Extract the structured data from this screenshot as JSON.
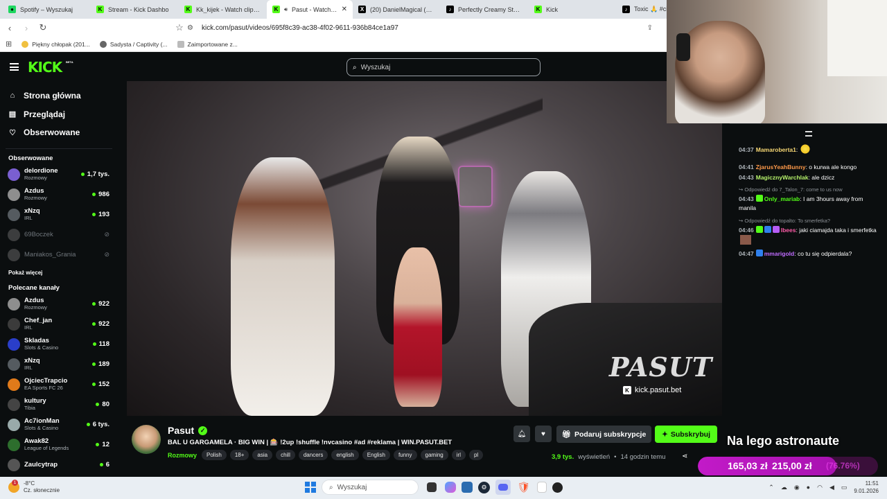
{
  "browser": {
    "tabs": [
      {
        "label": "Spotify – Wyszukaj",
        "color": "#1ed760",
        "glyph": "●"
      },
      {
        "label": "Stream - Kick Dashbo",
        "color": "#53fc18",
        "glyph": "K"
      },
      {
        "label": "Kk_kijek - Watch clips on",
        "color": "#53fc18",
        "glyph": "K"
      },
      {
        "label": "Pasut - Watch the",
        "color": "#53fc18",
        "glyph": "K",
        "active": true
      },
      {
        "label": "(20) DanielMagical (@dan",
        "color": "#000000",
        "glyph": "X"
      },
      {
        "label": "Perfectly Creamy Starbuck",
        "color": "#000000",
        "glyph": "♪"
      },
      {
        "label": "Kick",
        "color": "#53fc18",
        "glyph": "K"
      },
      {
        "label": "Toxic 🙏 #cio",
        "color": "#000000",
        "glyph": "♪"
      }
    ],
    "url": "kick.com/pasut/videos/695f8c39-ac38-4f02-9611-936b84ce1a97",
    "bookmarks": [
      "Piękny chłopak (201...",
      "Sadysta / Captivity (...",
      "Zaimportowane z..."
    ]
  },
  "header": {
    "logo": "KICK",
    "beta": "BETA",
    "search_placeholder": "Wyszukaj"
  },
  "sidebar": {
    "nav": [
      {
        "label": "Strona główna",
        "icon": "home-icon"
      },
      {
        "label": "Przeglądaj",
        "icon": "browse-icon"
      },
      {
        "label": "Obserwowane",
        "icon": "heart-icon"
      }
    ],
    "followed_heading": "Obserwowane",
    "followed": [
      {
        "name": "delordione",
        "category": "Rozmowy",
        "viewers": "1,7 tys.",
        "color": "#7a5fd1"
      },
      {
        "name": "Azdus",
        "category": "Rozmowy",
        "viewers": "986",
        "color": "#8e8e8e"
      },
      {
        "name": "xNzq",
        "category": "IRL",
        "viewers": "193",
        "color": "#555b60"
      },
      {
        "name": "69Boczek",
        "offline": true,
        "color": "#777"
      },
      {
        "name": "Maniakos_Grania",
        "offline": true,
        "color": "#777"
      }
    ],
    "show_more": "Pokaż więcej",
    "recommended_heading": "Polecane kanały",
    "recommended": [
      {
        "name": "Azdus",
        "category": "Rozmowy",
        "viewers": "922",
        "color": "#8e8e8e"
      },
      {
        "name": "Chef_jan",
        "category": "IRL",
        "viewers": "922",
        "color": "#3b3b3b"
      },
      {
        "name": "Skladas",
        "category": "Slots & Casino",
        "viewers": "118",
        "color": "#2a3ec9"
      },
      {
        "name": "xNzq",
        "category": "IRL",
        "viewers": "189",
        "color": "#555b60"
      },
      {
        "name": "OjciecTrapcio",
        "category": "EA Sports FC 26",
        "viewers": "152",
        "color": "#e07a1a"
      },
      {
        "name": "kultury",
        "category": "Tibia",
        "viewers": "80",
        "color": "#444"
      },
      {
        "name": "Ac7ionMan",
        "category": "Slots & Casino",
        "viewers": "6 tys.",
        "color": "#9aa"
      },
      {
        "name": "Awak82",
        "category": "League of Legends",
        "viewers": "12",
        "color": "#2d6e2d"
      },
      {
        "name": "Zaulcytrap",
        "category": "",
        "viewers": "6",
        "color": "#555"
      }
    ]
  },
  "video": {
    "watermark": "PASUT",
    "watermark_url": "kick.pasut.bet"
  },
  "streamer": {
    "name": "Pasut",
    "title": "BAL U GARGAMELA · BIG WIN | 🎰 !2up !shuffle !nvcasino #ad #reklama | WIN.PASUT.BET",
    "category": "Rozmowy",
    "tags": [
      "Polish",
      "18+",
      "asia",
      "chill",
      "dancers",
      "english",
      "English",
      "funny",
      "gaming",
      "irl",
      "pl"
    ],
    "gift_label": "Podaruj subskrypcje",
    "subscribe_label": "Subskrybuj",
    "views_count": "3,9 tys.",
    "views_label": "wyświetleń",
    "time_ago": "14 godzin temu"
  },
  "chat": {
    "messages": [
      {
        "time": "04:37",
        "user": "Mamaroberta1",
        "color": "#f7d774",
        "text": "",
        "emote": true
      },
      {
        "time": "04:41",
        "user": "ZjarusYeahBunny",
        "color": "#ff9a4a",
        "text": "o kurwa ale kongo"
      },
      {
        "time": "04:43",
        "user": "MagicznyWarchlak",
        "color": "#b6f26b",
        "text": "ale dzicz"
      },
      {
        "reply": "Odpowiedź do 7_Talon_7: come to us now"
      },
      {
        "time": "04:43",
        "user": "Only_mariab",
        "color": "#53fc18",
        "text": "I am 3hours away from manila"
      },
      {
        "reply": "Odpowiedź do topalto: To smerfetka?"
      },
      {
        "time": "04:46",
        "user": "lbees",
        "color": "#ff5ca8",
        "text": "jaki ciamajda taka i smerfetka"
      },
      {
        "time": "04:47",
        "user": "mmarigold",
        "color": "#c06cff",
        "text": "co tu się odpierdala?"
      }
    ]
  },
  "overlay": {
    "goal_title": "Na lego astronaute",
    "current": "165,03 zł",
    "target": "215,00 zł",
    "percent_label": "(76.76%)",
    "progress": 0.7676
  },
  "taskbar": {
    "temperature": "-8°C",
    "weather": "Cz. słonecznie",
    "notification_count": "1",
    "search_placeholder": "Wyszukaj",
    "time": "11:51",
    "date": "9.01.2026"
  }
}
